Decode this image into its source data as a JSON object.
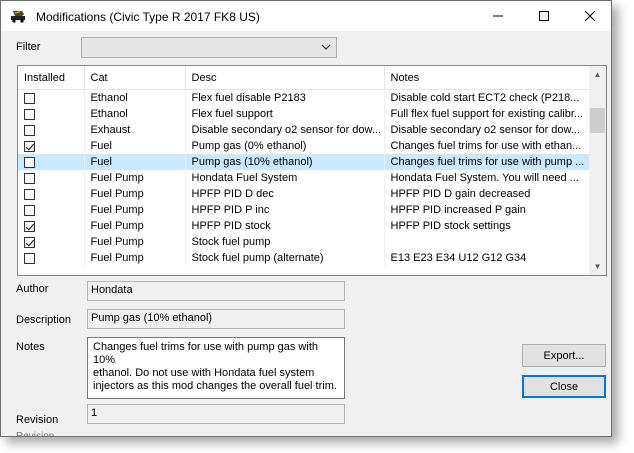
{
  "window": {
    "title": "Modifications (Civic Type R 2017 FK8 US)"
  },
  "filter": {
    "label": "Filter",
    "value": ""
  },
  "grid": {
    "columns": [
      "Installed",
      "Cat",
      "Desc",
      "Notes"
    ],
    "rows": [
      {
        "installed": false,
        "cat": "Ethanol",
        "desc": "Flex fuel disable P2183",
        "notes": "Disable cold start ECT2 check (P218..."
      },
      {
        "installed": false,
        "cat": "Ethanol",
        "desc": "Flex fuel support",
        "notes": "Full flex fuel support for existing calibr..."
      },
      {
        "installed": false,
        "cat": "Exhaust",
        "desc": "Disable secondary o2 sensor for dow...",
        "notes": "Disable secondary o2 sensor for dow..."
      },
      {
        "installed": true,
        "cat": "Fuel",
        "desc": "Pump gas (0% ethanol)",
        "notes": "Changes fuel trims for use with ethan..."
      },
      {
        "installed": false,
        "cat": "Fuel",
        "desc": "Pump gas (10% ethanol)",
        "notes": "Changes fuel trims for use with pump ...",
        "selected": true
      },
      {
        "installed": false,
        "cat": "Fuel Pump",
        "desc": "Hondata Fuel System",
        "notes": "Hondata Fuel System.  You will need ..."
      },
      {
        "installed": false,
        "cat": "Fuel Pump",
        "desc": "HPFP PID D dec",
        "notes": "HPFP PID D gain decreased"
      },
      {
        "installed": false,
        "cat": "Fuel Pump",
        "desc": "HPFP PID P inc",
        "notes": "HPFP PID increased P gain"
      },
      {
        "installed": true,
        "cat": "Fuel Pump",
        "desc": "HPFP PID stock",
        "notes": "HPFP PID stock settings"
      },
      {
        "installed": true,
        "cat": "Fuel Pump",
        "desc": "Stock fuel pump",
        "notes": ""
      },
      {
        "installed": false,
        "cat": "Fuel Pump",
        "desc": "Stock fuel pump (alternate)",
        "notes": "E13 E23 E34 U12 G12 G34"
      }
    ]
  },
  "details": {
    "author_label": "Author",
    "author_value": "Hondata",
    "description_label": "Description",
    "description_value": "Pump gas (10% ethanol)",
    "notes_label": "Notes",
    "notes_value": "Changes fuel trims for use with pump gas with 10%\nethanol. Do not use with Hondata fuel system\ninjectors as this mod changes the overall fuel trim.",
    "revision_label": "Revision",
    "revision_value": "1",
    "revision_label_2": "Revision"
  },
  "buttons": {
    "export": "Export...",
    "close": "Close"
  }
}
